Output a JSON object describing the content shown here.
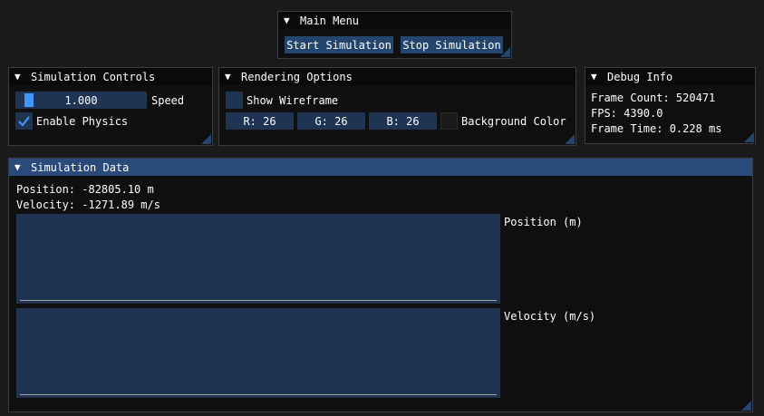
{
  "main_menu": {
    "title": "Main Menu",
    "start_label": "Start Simulation",
    "stop_label": "Stop Simulation"
  },
  "sim_controls": {
    "title": "Simulation Controls",
    "speed_value": "1.000",
    "speed_fraction": 0.06,
    "speed_label": "Speed",
    "physics_label": "Enable Physics",
    "physics_checked": true
  },
  "rendering": {
    "title": "Rendering Options",
    "wireframe_label": "Show Wireframe",
    "wireframe_checked": false,
    "r": "R: 26",
    "g": "G: 26",
    "b": "B: 26",
    "bg_label": "Background Color",
    "bg_color": "#1a1a1a"
  },
  "debug": {
    "title": "Debug Info",
    "frame_count": "Frame Count: 520471",
    "fps": "FPS: 4390.0",
    "frame_time": "Frame Time: 0.228 ms"
  },
  "sim_data": {
    "title": "Simulation Data",
    "position": "Position: -82805.10 m",
    "velocity": "Velocity: -1271.89 m/s",
    "position_plot_label": "Position (m)",
    "velocity_plot_label": "Velocity (m/s)"
  },
  "colors": {
    "accent": "#4296fa",
    "frame_bg": "#1f3452",
    "button": "#24466e",
    "title_active": "#294a7a",
    "window_bg": "#0f0f0f"
  }
}
